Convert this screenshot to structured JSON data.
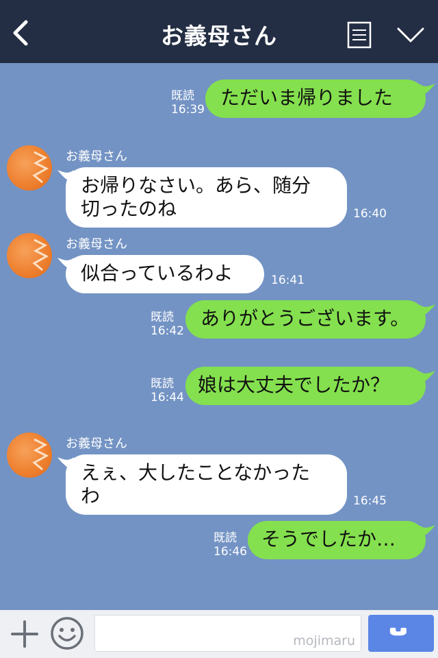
{
  "header": {
    "title": "お義母さん"
  },
  "messages": {
    "m1": {
      "text": "ただいま帰りました",
      "read": "既読",
      "time": "16:39"
    },
    "m2": {
      "sender": "お義母さん",
      "line1": "お帰りなさい。あら、随分",
      "line2": "切ったのね",
      "time": "16:40"
    },
    "m3": {
      "sender": "お義母さん",
      "text": "似合っているわよ",
      "time": "16:41"
    },
    "m4": {
      "text": "ありがとうございます。",
      "read": "既読",
      "time": "16:42"
    },
    "m5": {
      "text": "娘は大丈夫でしたか？",
      "read": "既読",
      "time": "16:44"
    },
    "m6": {
      "sender": "お義母さん",
      "line1": "えぇ、大したことなかった",
      "line2": "わ",
      "time": "16:45"
    },
    "m7": {
      "text": "そうでしたか…",
      "read": "既読",
      "time": "16:46"
    }
  },
  "input": {
    "placeholder": "",
    "watermark": "mojimaru"
  },
  "colors": {
    "header_bg": "#232e44",
    "chat_bg": "#7393c4",
    "outgoing_bubble": "#84e04e",
    "incoming_bubble": "#ffffff",
    "call_button": "#5b86e6"
  },
  "icons": {
    "back": "back-chevron-icon",
    "notes": "notes-icon",
    "dropdown": "chevron-down-icon",
    "plus": "plus-icon",
    "emoji": "smiley-icon",
    "call": "phone-icon"
  }
}
